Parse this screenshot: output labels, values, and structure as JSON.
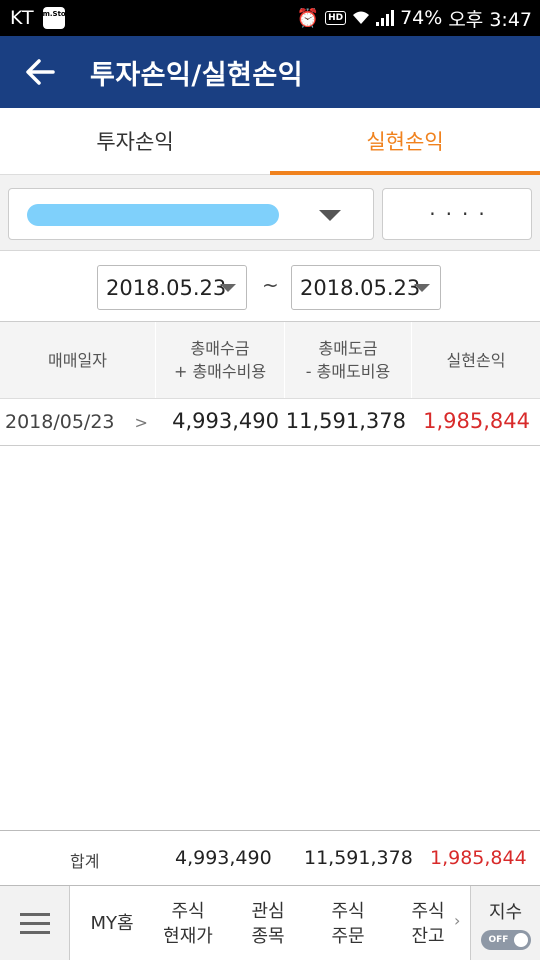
{
  "status_bar": {
    "carrier": "KT",
    "app_icon_text": "m.Stock",
    "battery": "74%",
    "time": "오후 3:47",
    "hd_badge": "HD"
  },
  "header": {
    "title": "투자손익/실현손익"
  },
  "tabs": [
    {
      "label": "투자손익",
      "active": false
    },
    {
      "label": "실현손익",
      "active": true
    }
  ],
  "filter": {
    "password_mask": "····"
  },
  "date_range": {
    "start": "2018.05.23",
    "separator": "~",
    "end": "2018.05.23"
  },
  "table": {
    "headers": [
      {
        "line1": "매매일자",
        "line2": ""
      },
      {
        "line1": "총매수금",
        "line2": "+ 총매수비용"
      },
      {
        "line1": "총매도금",
        "line2": "- 총매도비용"
      },
      {
        "line1": "실현손익",
        "line2": ""
      }
    ],
    "rows": [
      {
        "date": "2018/05/23",
        "chevron": ">",
        "buy": "4,993,490",
        "sell": "11,591,378",
        "profit": "1,985,844"
      }
    ]
  },
  "total": {
    "label": "합계",
    "buy": "4,993,490",
    "sell": "11,591,378",
    "profit": "1,985,844"
  },
  "bottom_nav": {
    "items": [
      {
        "line1": "MY홈",
        "line2": ""
      },
      {
        "line1": "주식",
        "line2": "현재가"
      },
      {
        "line1": "관심",
        "line2": "종목"
      },
      {
        "line1": "주식",
        "line2": "주문"
      },
      {
        "line1": "주식",
        "line2": "잔고"
      }
    ],
    "more": "›",
    "index_label": "지수",
    "toggle_text": "OFF"
  },
  "colors": {
    "header_bg": "#1a3f82",
    "active_tab": "#f0821e",
    "profit": "#d82a2a"
  }
}
